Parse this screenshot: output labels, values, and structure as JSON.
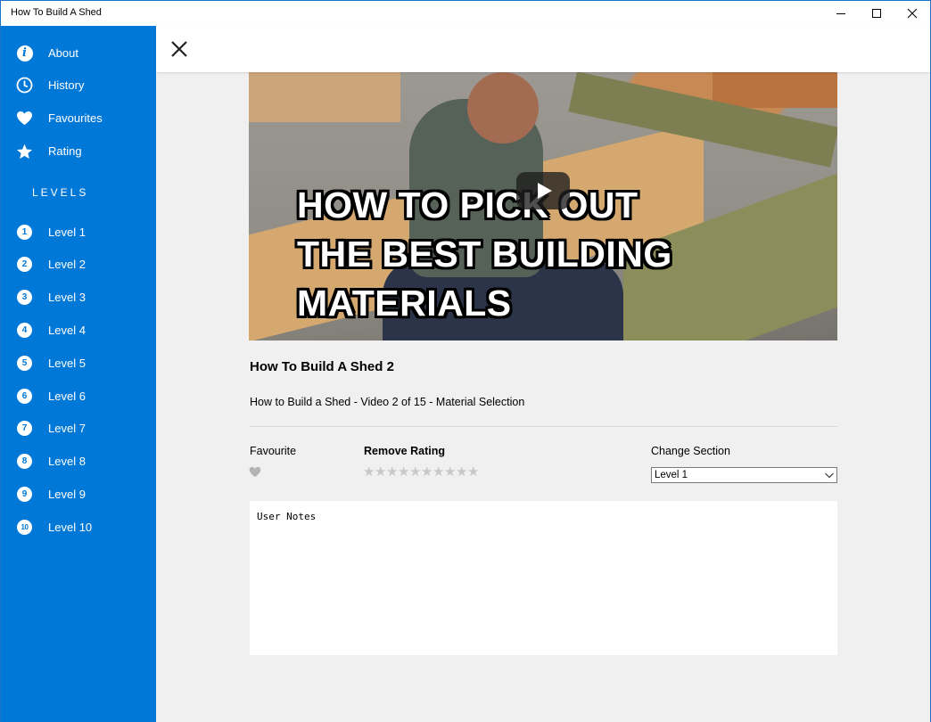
{
  "window": {
    "title": "How To Build A Shed"
  },
  "sidebar": {
    "items": [
      {
        "label": "About",
        "icon": "info-icon"
      },
      {
        "label": "History",
        "icon": "clock-icon"
      },
      {
        "label": "Favourites",
        "icon": "heart-icon"
      },
      {
        "label": "Rating",
        "icon": "star-icon"
      }
    ],
    "levels_header": "LEVELS",
    "levels": [
      {
        "num": "1",
        "label": "Level 1"
      },
      {
        "num": "2",
        "label": "Level 2"
      },
      {
        "num": "3",
        "label": "Level 3"
      },
      {
        "num": "4",
        "label": "Level 4"
      },
      {
        "num": "5",
        "label": "Level 5"
      },
      {
        "num": "6",
        "label": "Level 6"
      },
      {
        "num": "7",
        "label": "Level 7"
      },
      {
        "num": "8",
        "label": "Level 8"
      },
      {
        "num": "9",
        "label": "Level 9"
      },
      {
        "num": "10",
        "label": "Level 10"
      }
    ]
  },
  "video": {
    "caption_lines": [
      "HOW TO PICK OUT",
      "THE BEST BUILDING",
      "MATERIALS"
    ],
    "title": "How To Build A Shed 2",
    "description": "How to Build a Shed - Video 2 of 15 - Material Selection"
  },
  "controls": {
    "favourite_label": "Favourite",
    "rating_label": "Remove Rating",
    "rating_value": 0,
    "rating_max": 10,
    "section_label": "Change Section",
    "section_value": "Level 1"
  },
  "notes": {
    "placeholder": "User Notes"
  },
  "colors": {
    "accent": "#0078d7",
    "content_bg": "#f0f0f0",
    "star_inactive": "#c8c8c8"
  }
}
